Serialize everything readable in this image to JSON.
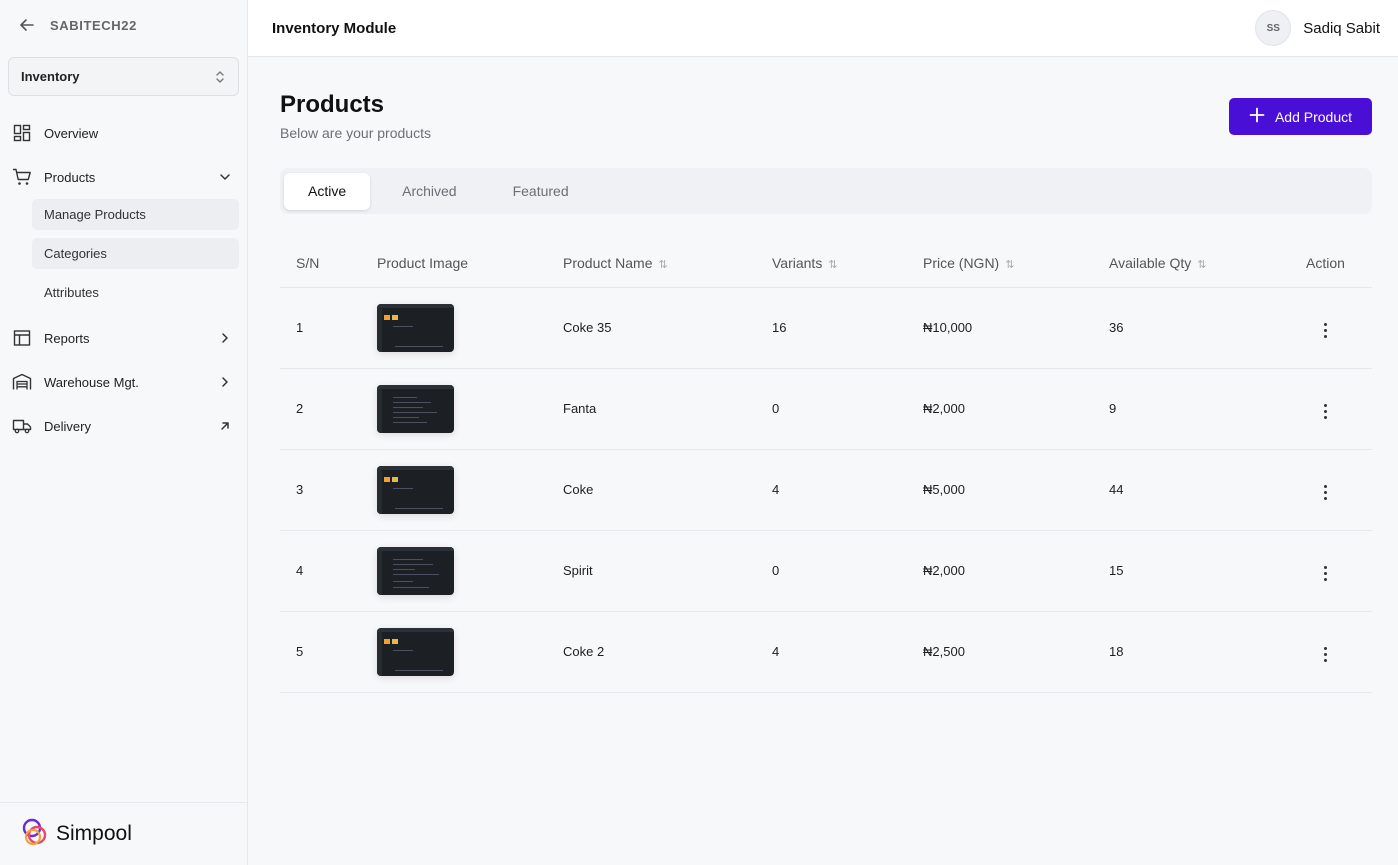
{
  "org": {
    "name": "SABITECH22"
  },
  "module_select": {
    "value": "Inventory"
  },
  "nav": {
    "overview": "Overview",
    "products": "Products",
    "sub": [
      "Manage Products",
      "Categories",
      "Attributes"
    ],
    "reports": "Reports",
    "warehouse": "Warehouse Mgt.",
    "delivery": "Delivery"
  },
  "brand": {
    "name": "Simpool"
  },
  "topbar": {
    "title": "Inventory Module",
    "avatar_initials": "SS",
    "user_name": "Sadiq Sabit"
  },
  "page": {
    "title": "Products",
    "subtitle": "Below are your products",
    "add_button": "Add Product"
  },
  "tabs": [
    "Active",
    "Archived",
    "Featured"
  ],
  "table": {
    "headers": [
      "S/N",
      "Product Image",
      "Product Name",
      "Variants",
      "Price (NGN)",
      "Available Qty",
      "Action"
    ],
    "rows": [
      {
        "sn": "1",
        "name": "Coke 35",
        "variants": "16",
        "price": "₦10,000",
        "qty": "36"
      },
      {
        "sn": "2",
        "name": "Fanta",
        "variants": "0",
        "price": "₦2,000",
        "qty": "9"
      },
      {
        "sn": "3",
        "name": "Coke",
        "variants": "4",
        "price": "₦5,000",
        "qty": "44"
      },
      {
        "sn": "4",
        "name": "Spirit",
        "variants": "0",
        "price": "₦2,000",
        "qty": "15"
      },
      {
        "sn": "5",
        "name": "Coke 2",
        "variants": "4",
        "price": "₦2,500",
        "qty": "18"
      }
    ]
  },
  "colors": {
    "primary": "#4a0fd6"
  }
}
